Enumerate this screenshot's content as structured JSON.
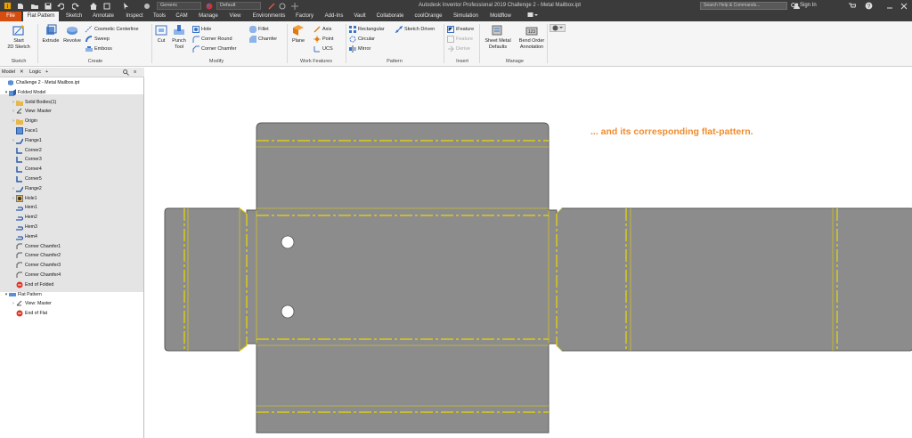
{
  "titlebar": {
    "quick_access_icons": [
      "app-menu-icon",
      "new-icon",
      "open-icon",
      "save-icon",
      "undo-icon",
      "redo-icon",
      "home-icon",
      "update-icon",
      "select-icon",
      "material-icon",
      "appearance-icon",
      "clear-icon",
      "measure-icon",
      "add-icon"
    ],
    "material_combo": "Generic",
    "appearance_combo": "Default",
    "window_title": "Autodesk Inventor Professional 2019   Challenge 2 - Metal Mailbox.ipt",
    "search_placeholder": "Search Help & Commands...",
    "sign_in": "Sign In",
    "help": "?"
  },
  "menu_tabs": [
    "File",
    "Flat Pattern",
    "Sketch",
    "Annotate",
    "Inspect",
    "Tools",
    "CAM",
    "Manage",
    "View",
    "Environments",
    "Factory",
    "Add-Ins",
    "Vault",
    "Collaborate",
    "coolOrange",
    "Simulation",
    "Moldflow"
  ],
  "ribbon": {
    "sketch": {
      "start_sketch": "Start\n2D Sketch",
      "panel": "Sketch"
    },
    "create": {
      "extrude": "Extrude",
      "revolve": "Revolve",
      "cosmetic_centerline": "Cosmetic Centerline",
      "sweep": "Sweep",
      "emboss": "Emboss",
      "panel": "Create"
    },
    "modify": {
      "cut": "Cut",
      "punch_tool": "Punch\nTool",
      "hole": "Hole",
      "corner_round": "Corner Round",
      "corner_chamfer": "Corner Chamfer",
      "fillet": "Fillet",
      "chamfer": "Chamfer",
      "panel": "Modify"
    },
    "work_features": {
      "plane": "Plane",
      "axis": "Axis",
      "point": "Point",
      "ucs": "UCS",
      "panel": "Work Features"
    },
    "pattern": {
      "rectangular": "Rectangular",
      "circular": "Circular",
      "mirror": "Mirror",
      "sketch_driven": "Sketch Driven",
      "panel": "Pattern"
    },
    "insert": {
      "ifeature": "iFeature",
      "feature": "Feature",
      "derive": "Derive",
      "panel": "Insert"
    },
    "manage": {
      "sheet_metal_defaults": "Sheet Metal\nDefaults",
      "bend_order": "Bend Order\nAnnotation",
      "panel": "Manage"
    }
  },
  "browser": {
    "tab_model": "Model",
    "tab_logic": "Logic",
    "tree": [
      {
        "label": "Challenge 2 - Metal Mailbox.ipt",
        "icon": "part-icon"
      },
      {
        "label": "Folded Model",
        "icon": "folded-model-icon"
      },
      {
        "label": "Solid Bodies(1)",
        "icon": "solid-bodies-icon"
      },
      {
        "label": "View: Master",
        "icon": "view-icon"
      },
      {
        "label": "Origin",
        "icon": "folder-icon"
      },
      {
        "label": "Face1",
        "icon": "face-icon"
      },
      {
        "label": "Flange1",
        "icon": "flange-icon"
      },
      {
        "label": "Corner2",
        "icon": "corner-icon"
      },
      {
        "label": "Corner3",
        "icon": "corner-icon"
      },
      {
        "label": "Corner4",
        "icon": "corner-icon"
      },
      {
        "label": "Corner5",
        "icon": "corner-icon"
      },
      {
        "label": "Flange2",
        "icon": "flange-icon"
      },
      {
        "label": "Hole1",
        "icon": "hole-icon"
      },
      {
        "label": "Hem1",
        "icon": "hem-icon"
      },
      {
        "label": "Hem2",
        "icon": "hem-icon"
      },
      {
        "label": "Hem3",
        "icon": "hem-icon"
      },
      {
        "label": "Hem4",
        "icon": "hem-icon"
      },
      {
        "label": "Corner Chamfer1",
        "icon": "corner-chamfer-icon"
      },
      {
        "label": "Corner Chamfer2",
        "icon": "corner-chamfer-icon"
      },
      {
        "label": "Corner Chamfer3",
        "icon": "corner-chamfer-icon"
      },
      {
        "label": "Corner Chamfer4",
        "icon": "corner-chamfer-icon"
      },
      {
        "label": "End of Folded",
        "icon": "end-of-part-icon"
      },
      {
        "label": "Flat Pattern",
        "icon": "flat-pattern-icon"
      },
      {
        "label": "View: Master",
        "icon": "view-icon"
      },
      {
        "label": "End of Flat",
        "icon": "end-of-part-icon"
      }
    ]
  },
  "annotation": "... and its corresponding flat-pattern.",
  "colors": {
    "accent": "#d64d10",
    "sheet_fill": "#8c8c8c",
    "bend_line": "#e8d800",
    "annotation": "#f08c2e"
  }
}
